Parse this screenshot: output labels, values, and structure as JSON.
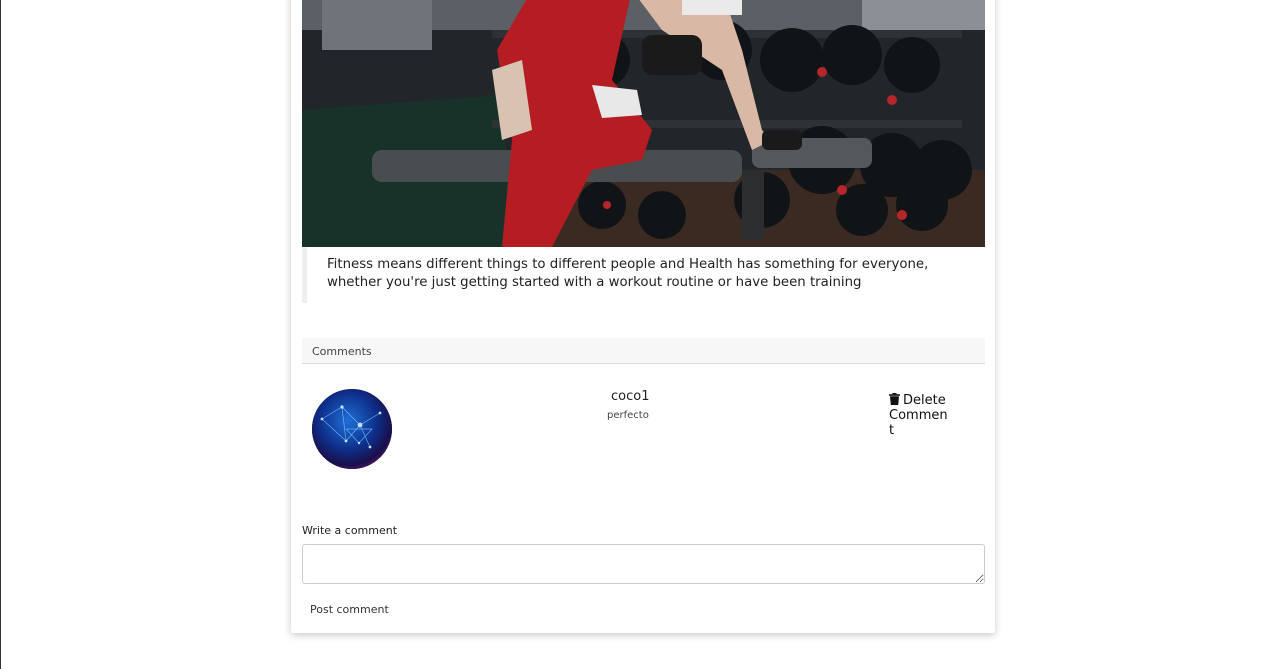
{
  "post": {
    "image_alt": "Woman training with dumbbells in a gym",
    "quote": "Fitness means different things to different people and Health has something for everyone, whether you're just getting started with a workout routine or have been training"
  },
  "comments": {
    "header": "Comments",
    "items": [
      {
        "author": "coco1",
        "text": "perfecto",
        "delete_label": "Delete Comment"
      }
    ]
  },
  "form": {
    "label": "Write a comment",
    "input_value": "",
    "input_placeholder": "",
    "submit_label": "Post comment"
  },
  "icons": {
    "delete": "trash-icon",
    "avatar": "constellation-avatar"
  }
}
